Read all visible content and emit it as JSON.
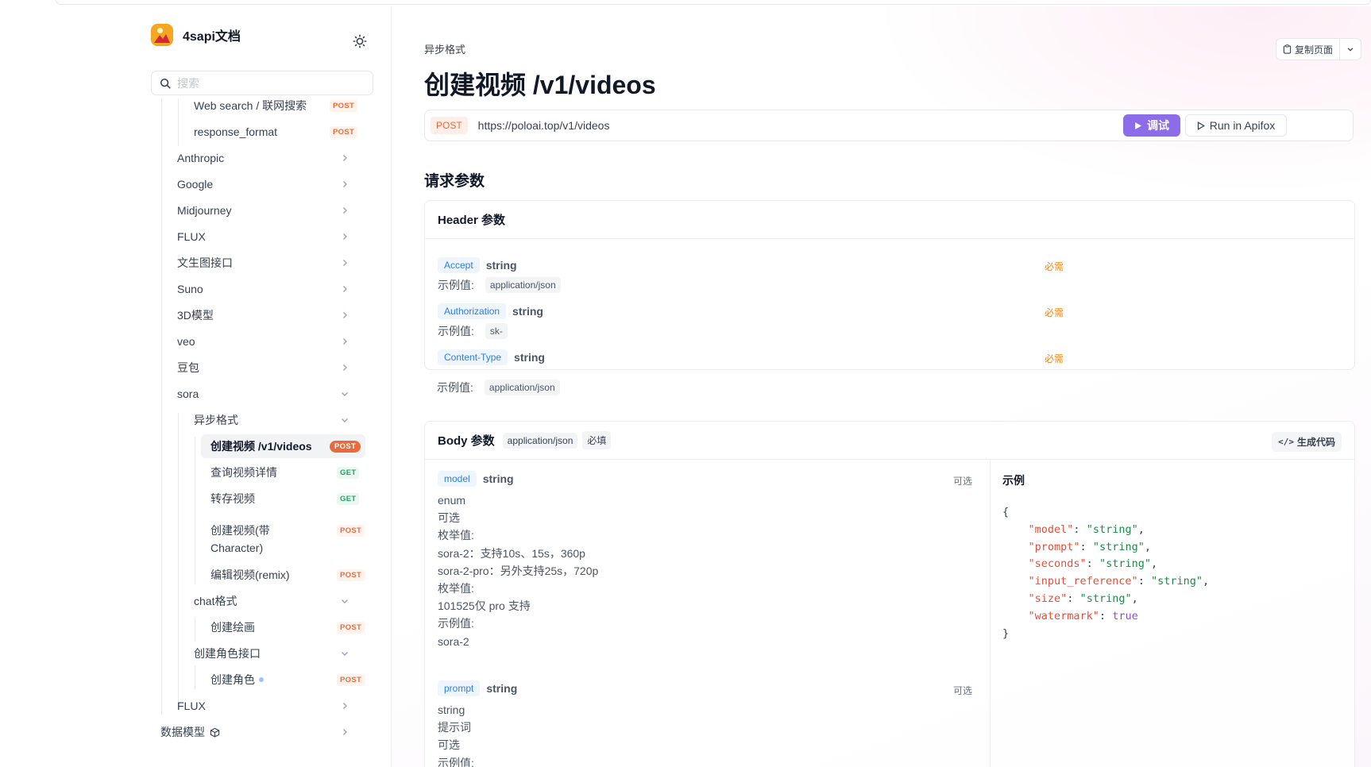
{
  "brand": {
    "name": "4sapi文档"
  },
  "search": {
    "placeholder": "搜索"
  },
  "sidebar": {
    "items": [
      {
        "label": "Web search / 联网搜索",
        "badge": "POST"
      },
      {
        "label": "response_format",
        "badge": "POST"
      },
      {
        "label": "Anthropic"
      },
      {
        "label": "Google"
      },
      {
        "label": "Midjourney"
      },
      {
        "label": "FLUX"
      },
      {
        "label": "文生图接口"
      },
      {
        "label": "Suno"
      },
      {
        "label": "3D模型"
      },
      {
        "label": "veo"
      },
      {
        "label": "豆包"
      },
      {
        "label": "sora"
      },
      {
        "label": "异步格式"
      },
      {
        "label": "创建视频 /v1/videos",
        "badge": "POST"
      },
      {
        "label": "查询视频详情",
        "badge": "GET"
      },
      {
        "label": "转存视频",
        "badge": "GET"
      },
      {
        "label": "创建视频(带",
        "label2": "Character)",
        "badge": "POST"
      },
      {
        "label": "编辑视频(remix)",
        "badge": "POST"
      },
      {
        "label": "chat格式"
      },
      {
        "label": "创建绘画",
        "badge": "POST"
      },
      {
        "label": "创建角色接口"
      },
      {
        "label": "创建角色",
        "badge": "POST"
      },
      {
        "label": "FLUX"
      },
      {
        "label": "数据模型"
      }
    ]
  },
  "page": {
    "breadcrumb": "异步格式",
    "title": "创建视频 /v1/videos",
    "copy_label": "复制页面",
    "method": "POST",
    "url": "https://poloai.top/v1/videos",
    "debug_label": "调试",
    "apifox_label": "Run in Apifox",
    "section_title": "请求参数"
  },
  "header_params": {
    "title": "Header 参数",
    "example_label": "示例值:",
    "params": [
      {
        "name": "Accept",
        "type": "string",
        "required": "必需",
        "example": "application/json"
      },
      {
        "name": "Authorization",
        "type": "string",
        "required": "必需",
        "example": "sk-"
      },
      {
        "name": "Content-Type",
        "type": "string",
        "required": "必需",
        "example": "application/json"
      }
    ]
  },
  "body_params": {
    "title": "Body 参数",
    "content_type": "application/json",
    "required_chip": "必填",
    "gen_code_label": "生成代码",
    "example_title": "示例",
    "model": {
      "name": "model",
      "type": "string",
      "optional": "可选",
      "lines": [
        "enum",
        "可选",
        "枚举值:",
        "sora-2：支持10s、15s，360p",
        "sora-2-pro：另外支持25s，720p",
        "枚举值:",
        "101525仅 pro 支持",
        "示例值:",
        "sora-2"
      ]
    },
    "prompt": {
      "name": "prompt",
      "type": "string",
      "optional": "可选",
      "lines": [
        "string",
        "提示词",
        "可选",
        "示例值:"
      ]
    },
    "example_json": {
      "model": "string",
      "prompt": "string",
      "seconds": "string",
      "input_reference": "string",
      "size": "string",
      "watermark": "true"
    }
  }
}
